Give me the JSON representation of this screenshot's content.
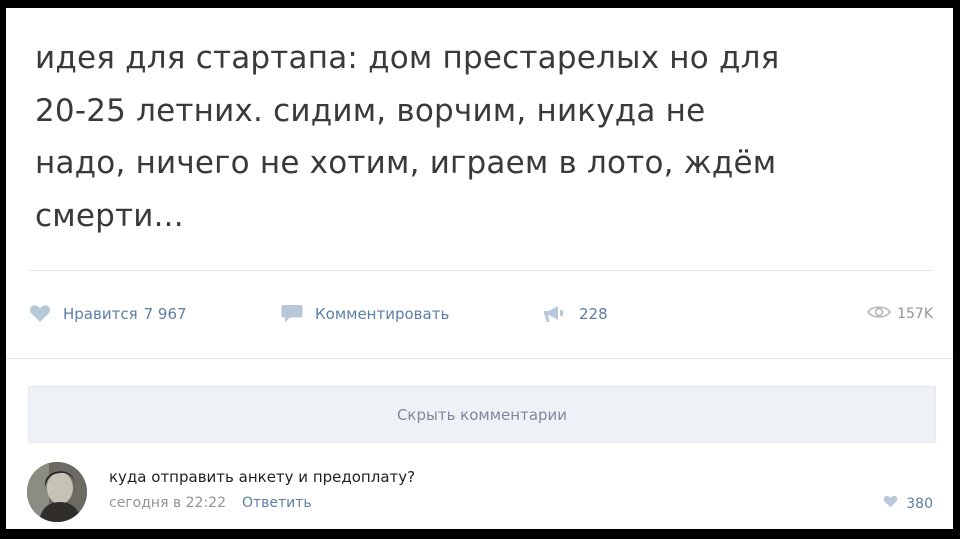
{
  "post": {
    "text": "идея для стартапа: дом престарелых но для\n20-25 летних. сидим, ворчим, никуда не\nнадо, ничего не хотим, играем в лото, ждём\nсмерти..."
  },
  "actions": {
    "like_label": "Нравится",
    "like_count": "7 967",
    "comment_label": "Комментировать",
    "share_count": "228",
    "views_count": "157K"
  },
  "hide_comments_label": "Скрыть комментарии",
  "comment": {
    "text": "куда отправить анкету и предоплату?",
    "time": "сегодня в 22:22",
    "reply_label": "Ответить",
    "likes": "380"
  },
  "colors": {
    "link": "#5d7ea7",
    "icon": "#b8c7d9",
    "muted": "#939393"
  },
  "icons": {
    "like": "heart-icon",
    "comment": "speech-bubble-icon",
    "share": "megaphone-icon",
    "views": "eye-icon"
  }
}
